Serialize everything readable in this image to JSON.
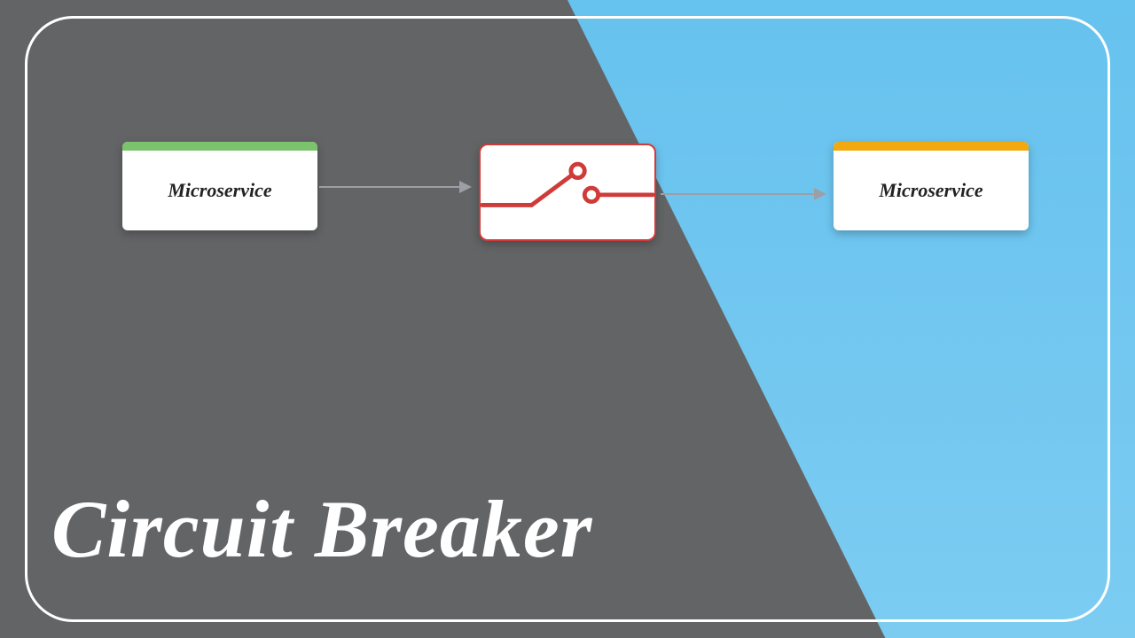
{
  "title": "Circuit Breaker",
  "nodes": {
    "left": {
      "label": "Microservice",
      "accent": "#7cc36e"
    },
    "right": {
      "label": "Microservice",
      "accent": "#f1a90f"
    },
    "middle": {
      "kind": "circuit-breaker-switch",
      "border": "#cf3b39",
      "state": "open"
    }
  },
  "edges": [
    {
      "from": "left",
      "to": "middle",
      "style": "arrow"
    },
    {
      "from": "middle",
      "to": "right",
      "style": "arrow"
    }
  ],
  "colors": {
    "bg_gray": "#636466",
    "bg_blue_top": "#66c2ee",
    "bg_blue_bottom": "#7cccf2",
    "frame": "#ffffff",
    "title": "#ffffff",
    "arrow": "#9aa0a6",
    "switch": "#cf3b39"
  }
}
